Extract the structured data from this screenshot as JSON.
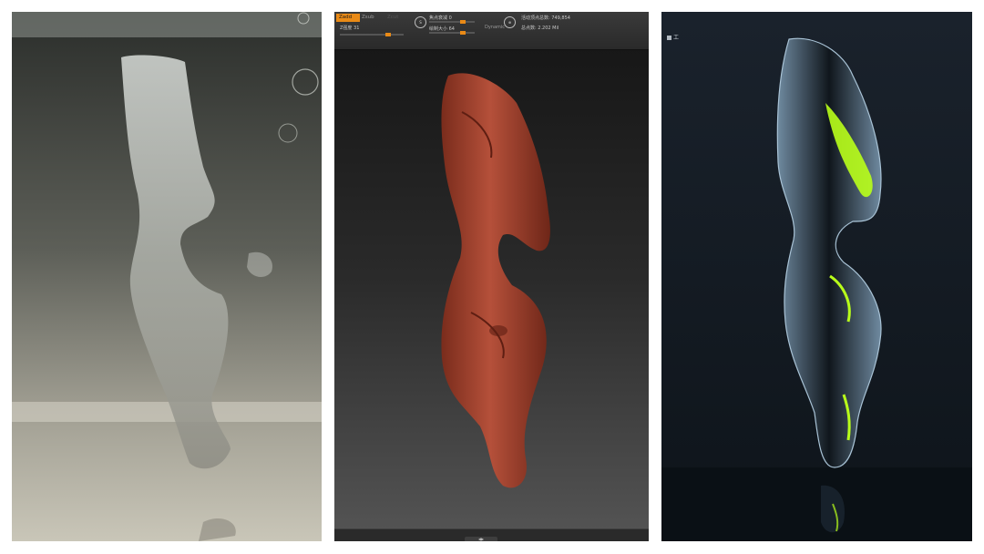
{
  "panels": [
    {
      "id": "photo",
      "description_visible": false
    },
    {
      "id": "zbrush"
    },
    {
      "id": "render"
    }
  ],
  "zbrush": {
    "zadd_label": "Zadd",
    "zsub_label": "Zsub",
    "zcut_label": "Zcut",
    "z_intensity": "Z强度 31",
    "focal_shift": "焦点衰减 0",
    "draw_size": "绘制大小 64",
    "dynamic_label": "Dynamic",
    "active_points": "活动顶点总数: 749,854",
    "total_points": "总点数: 2.202 Mil",
    "bottom_tab_label": "◀▶",
    "accent_color": "#e98a16"
  },
  "render_panel": {
    "ui_label": "工"
  }
}
